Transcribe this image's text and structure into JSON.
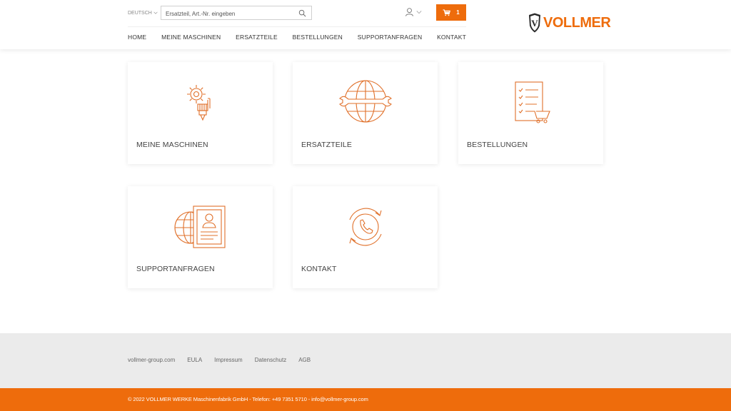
{
  "header": {
    "language": "DEUTSCH",
    "search_placeholder": "Ersatzteil, Art.-Nr. eingeben",
    "cart_count": "1",
    "logo_text": "VOLLMER",
    "logo_monogram": "V"
  },
  "nav": [
    "HOME",
    "MEINE MASCHINEN",
    "ERSATZTEILE",
    "BESTELLUNGEN",
    "SUPPORTANFRAGEN",
    "KONTAKT"
  ],
  "tiles": [
    {
      "label": "MEINE MASCHINEN",
      "icon": "machine-gear-icon"
    },
    {
      "label": "ERSATZTEILE",
      "icon": "globe-wrench-icon"
    },
    {
      "label": "BESTELLUNGEN",
      "icon": "checklist-cart-icon"
    },
    {
      "label": "SUPPORTANFRAGEN",
      "icon": "globe-profile-icon"
    },
    {
      "label": "KONTAKT",
      "icon": "phone-refresh-icon"
    }
  ],
  "footer": {
    "links": [
      "vollmer-group.com",
      "EULA",
      "Impressum",
      "Datenschutz",
      "AGB"
    ],
    "copyright": "© 2022 VOLLMER WERKE Maschinenfabrik GmbH - Telefon: +49 7351 5710 - info@vollmer-group.com"
  },
  "colors": {
    "accent": "#ee6c0c",
    "footer_grey": "#ebebeb"
  }
}
